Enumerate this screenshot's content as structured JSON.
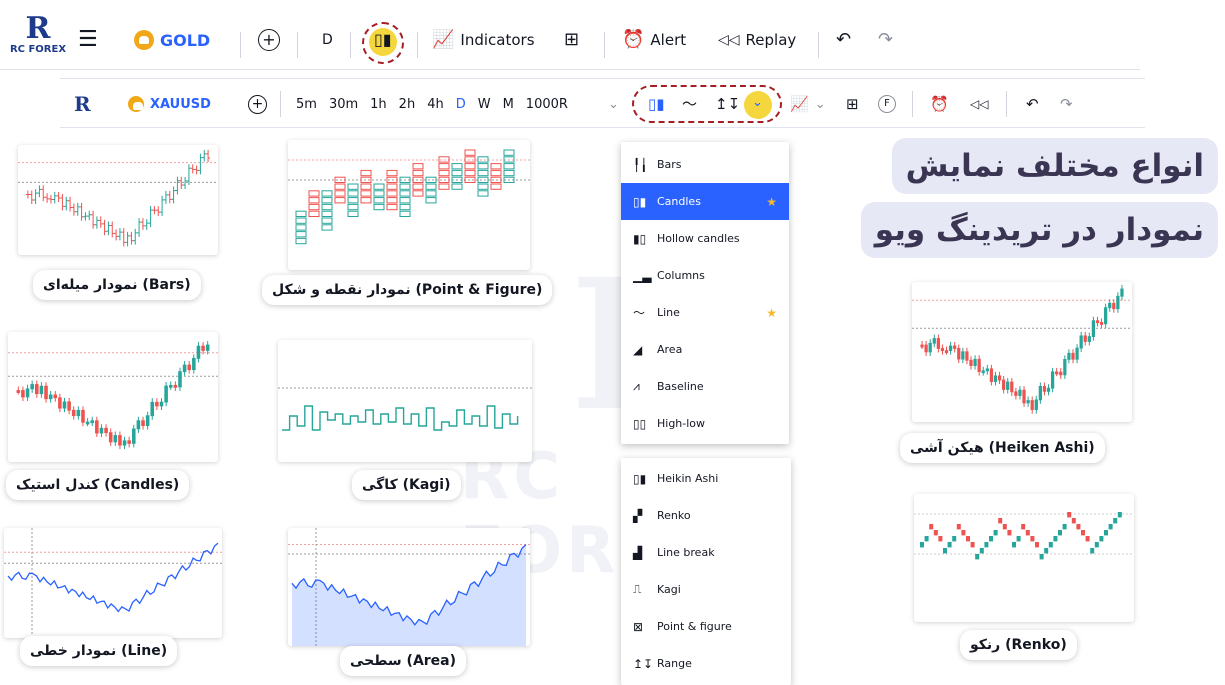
{
  "toolbar_main": {
    "logo_text": "RC FOREX",
    "symbol": "GOLD",
    "interval": "D",
    "indicators_label": "Indicators",
    "alert_label": "Alert",
    "replay_label": "Replay"
  },
  "toolbar_secondary": {
    "symbol": "XAUUSD",
    "timeframes": [
      "5m",
      "30m",
      "1h",
      "2h",
      "4h",
      "D",
      "W",
      "M",
      "1000R"
    ],
    "active_timeframe": "D"
  },
  "chart_types_menu": {
    "items": [
      {
        "label": "Bars",
        "icon": "bars-icon",
        "selected": false,
        "favorite": false
      },
      {
        "label": "Candles",
        "icon": "candles-icon",
        "selected": true,
        "favorite": true
      },
      {
        "label": "Hollow candles",
        "icon": "hollow-candles-icon",
        "selected": false,
        "favorite": false
      },
      {
        "label": "Columns",
        "icon": "columns-icon",
        "selected": false,
        "favorite": false
      },
      {
        "label": "Line",
        "icon": "line-icon",
        "selected": false,
        "favorite": true
      },
      {
        "label": "Area",
        "icon": "area-icon",
        "selected": false,
        "favorite": false
      },
      {
        "label": "Baseline",
        "icon": "baseline-icon",
        "selected": false,
        "favorite": false
      },
      {
        "label": "High-low",
        "icon": "high-low-icon",
        "selected": false,
        "favorite": false
      }
    ]
  },
  "chart_types_menu_2": {
    "items": [
      {
        "label": "Heikin Ashi",
        "icon": "heikin-ashi-icon"
      },
      {
        "label": "Renko",
        "icon": "renko-icon"
      },
      {
        "label": "Line break",
        "icon": "line-break-icon"
      },
      {
        "label": "Kagi",
        "icon": "kagi-icon"
      },
      {
        "label": "Point & figure",
        "icon": "point-figure-icon"
      },
      {
        "label": "Range",
        "icon": "range-icon"
      }
    ]
  },
  "title": {
    "line1": "انواع مختلف نمایش",
    "line2": "نمودار در تریدینگ ویو"
  },
  "captions": {
    "bars": "نمودار میله‌ای (Bars)",
    "point_figure": "نمودار نقطه و شکل (Point & Figure)",
    "candles": "کندل استیک (Candles)",
    "kagi": "کاگی (Kagi)",
    "line": "نمودار خطی (Line)",
    "area": "سطحی (Area)",
    "heiken_ashi": "هیکن آشی (Heiken Ashi)",
    "renko": "رنکو (Renko)"
  },
  "colors": {
    "accent_blue": "#2962ff",
    "up_green": "#26a69a",
    "down_red": "#ef5350",
    "highlight_red": "#a31f25",
    "highlight_yellow": "#f5d63d",
    "title_bg": "#e7e8f5"
  },
  "watermark": "RC FOREX"
}
